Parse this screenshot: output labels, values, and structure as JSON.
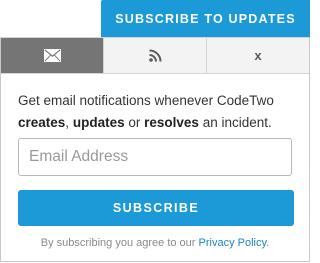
{
  "header": {
    "subscribe_updates_label": "SUBSCRIBE TO UPDATES"
  },
  "tabs": [
    {
      "icon": "envelope-icon",
      "glyph": "✉"
    },
    {
      "icon": "rss-icon",
      "glyph": ""
    },
    {
      "icon": "x-icon",
      "glyph": "x"
    }
  ],
  "description": {
    "prefix": "Get email notifications whenever CodeTwo",
    "word1": "creates",
    "sep1": ",",
    "word2": "updates",
    "sep2": "or",
    "word3": "resolves",
    "suffix": "an incident."
  },
  "email": {
    "placeholder": "Email Address"
  },
  "subscribe_label": "SUBSCRIBE",
  "legal": {
    "text": "By subscribing you agree to our",
    "link": "Privacy Policy",
    "end": "."
  },
  "colors": {
    "accent": "#1b9ad7",
    "active_tab": "#757575"
  }
}
